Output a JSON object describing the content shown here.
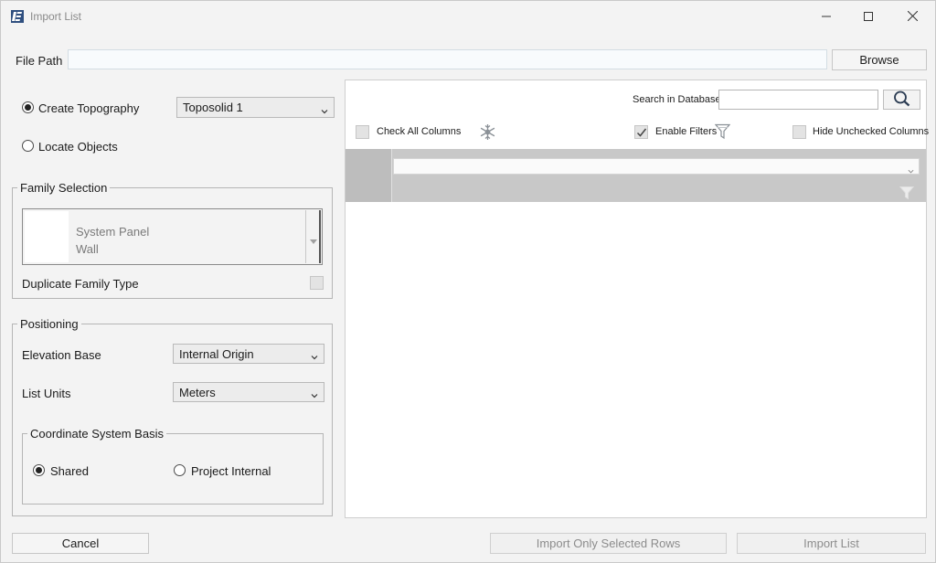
{
  "window": {
    "title": "Import List"
  },
  "file_path": {
    "label": "File Path",
    "value": "",
    "browse_label": "Browse"
  },
  "mode": {
    "create_topography_label": "Create Topography",
    "create_topography_checked": true,
    "topography_value": "Toposolid 1",
    "locate_objects_label": "Locate Objects",
    "locate_objects_checked": false
  },
  "family_selection": {
    "title": "Family Selection",
    "items": [
      {
        "label": "System Panel"
      },
      {
        "label": "Wall"
      }
    ],
    "duplicate_label": "Duplicate Family Type",
    "duplicate_checked": false
  },
  "positioning": {
    "title": "Positioning",
    "elevation_label": "Elevation Base",
    "elevation_value": "Internal Origin",
    "units_label": "List Units",
    "units_value": "Meters",
    "coord_title": "Coordinate System Basis",
    "shared_label": "Shared",
    "shared_checked": true,
    "project_internal_label": "Project Internal",
    "project_internal_checked": false
  },
  "database": {
    "search_label": "Search in Database",
    "search_value": "",
    "check_all_label": "Check All Columns",
    "check_all_checked": false,
    "enable_filters_label": "Enable Filters",
    "enable_filters_checked": true,
    "hide_unchecked_label": "Hide Unchecked Columns",
    "hide_unchecked_checked": false
  },
  "footer": {
    "cancel_label": "Cancel",
    "import_selected_label": "Import Only Selected Rows",
    "import_list_label": "Import List"
  }
}
